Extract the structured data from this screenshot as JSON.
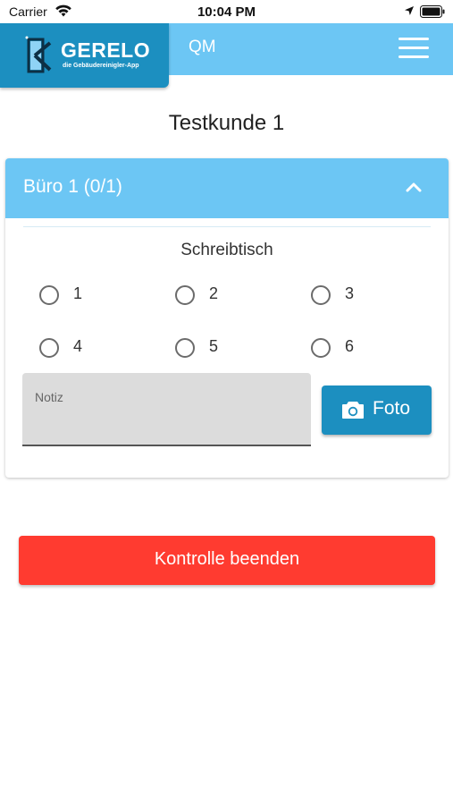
{
  "status_bar": {
    "carrier": "Carrier",
    "time": "10:04 PM"
  },
  "header": {
    "logo_title": "GERELO",
    "logo_subtitle": "die Gebäudereinigler-App",
    "title": "QM",
    "menu_icon": "hamburger-menu-icon"
  },
  "page": {
    "title": "Testkunde 1"
  },
  "section": {
    "label": "Büro 1 (0/1)",
    "expanded": true,
    "question": "Schreibtisch",
    "options": [
      "1",
      "2",
      "3",
      "4",
      "5",
      "6"
    ],
    "selected": null,
    "note_placeholder": "Notiz",
    "note_value": "",
    "photo_label": "Foto"
  },
  "actions": {
    "end_label": "Kontrolle beenden"
  },
  "colors": {
    "header": "#6cc6f4",
    "brand": "#1c8fc0",
    "danger": "#ff3b30"
  }
}
